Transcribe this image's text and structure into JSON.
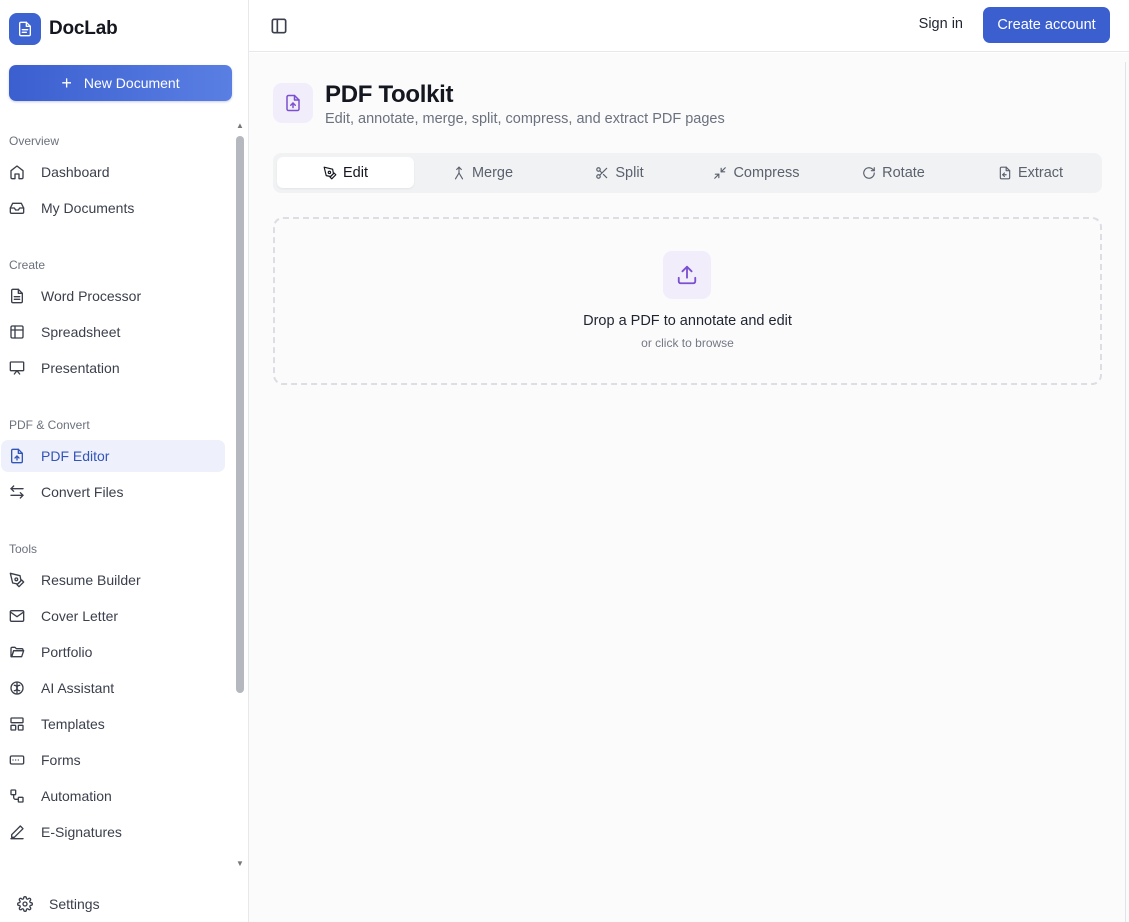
{
  "brand": {
    "name": "DocLab"
  },
  "sidebar": {
    "new_document_label": "New Document",
    "sections": [
      {
        "title": "Overview",
        "items": [
          {
            "label": "Dashboard",
            "icon": "home-icon"
          },
          {
            "label": "My Documents",
            "icon": "inbox-icon"
          }
        ]
      },
      {
        "title": "Create",
        "items": [
          {
            "label": "Word Processor",
            "icon": "document-icon"
          },
          {
            "label": "Spreadsheet",
            "icon": "table-icon"
          },
          {
            "label": "Presentation",
            "icon": "presentation-icon"
          }
        ]
      },
      {
        "title": "PDF & Convert",
        "items": [
          {
            "label": "PDF Editor",
            "icon": "file-upload-icon",
            "active": true
          },
          {
            "label": "Convert Files",
            "icon": "arrows-swap-icon"
          }
        ]
      },
      {
        "title": "Tools",
        "items": [
          {
            "label": "Resume Builder",
            "icon": "pen-tool-icon"
          },
          {
            "label": "Cover Letter",
            "icon": "mail-icon"
          },
          {
            "label": "Portfolio",
            "icon": "folder-open-icon"
          },
          {
            "label": "AI Assistant",
            "icon": "brain-icon"
          },
          {
            "label": "Templates",
            "icon": "layout-icon"
          },
          {
            "label": "Forms",
            "icon": "input-field-icon"
          },
          {
            "label": "Automation",
            "icon": "workflow-icon"
          },
          {
            "label": "E-Signatures",
            "icon": "pencil-icon"
          }
        ]
      }
    ],
    "settings_label": "Settings"
  },
  "topbar": {
    "signin_label": "Sign in",
    "create_account_label": "Create account"
  },
  "page": {
    "title": "PDF Toolkit",
    "subtitle": "Edit, annotate, merge, split, compress, and extract PDF pages"
  },
  "tabs": [
    {
      "label": "Edit",
      "icon": "pen-tool-icon",
      "active": true
    },
    {
      "label": "Merge",
      "icon": "merge-icon"
    },
    {
      "label": "Split",
      "icon": "scissors-icon"
    },
    {
      "label": "Compress",
      "icon": "minimize-icon"
    },
    {
      "label": "Rotate",
      "icon": "rotate-icon"
    },
    {
      "label": "Extract",
      "icon": "extract-icon"
    }
  ],
  "dropzone": {
    "title": "Drop a PDF to annotate and edit",
    "subtitle": "or click to browse"
  },
  "colors": {
    "accent": "#3b5fcf",
    "active_bg": "#eef1fb",
    "icon_tint": "#7a4fd0"
  }
}
